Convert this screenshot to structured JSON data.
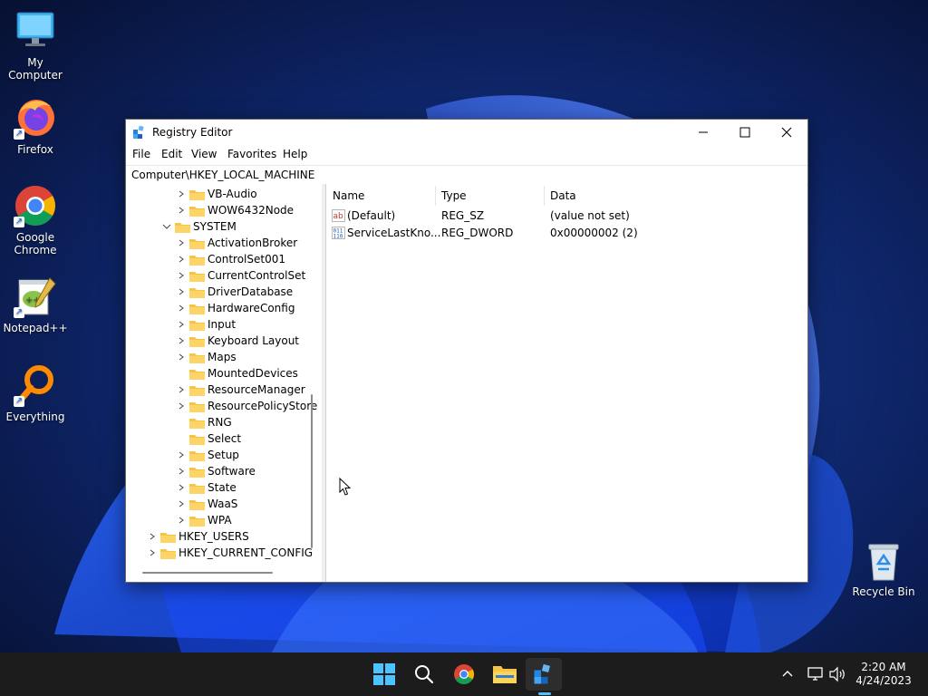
{
  "desktop": {
    "icons": [
      {
        "label": "My Computer",
        "icon": "monitor-icon"
      },
      {
        "label": "Firefox",
        "icon": "firefox-icon"
      },
      {
        "label": "Google Chrome",
        "icon": "chrome-icon"
      },
      {
        "label": "Notepad++",
        "icon": "notepadpp-icon"
      },
      {
        "label": "Everything",
        "icon": "search-everything-icon"
      }
    ],
    "recycle_bin": {
      "label": "Recycle Bin",
      "icon": "recycle-bin-icon"
    }
  },
  "window": {
    "title": "Registry Editor",
    "controls": {
      "minimize": "–",
      "maximize": "☐",
      "close": "✕"
    },
    "menu": [
      "File",
      "Edit",
      "View",
      "Favorites",
      "Help"
    ],
    "address": "Computer\\HKEY_LOCAL_MACHINE",
    "tree": [
      {
        "label": "VB-Audio",
        "expander": "collapsed"
      },
      {
        "label": "WOW6432Node",
        "expander": "collapsed"
      },
      {
        "label": "SYSTEM",
        "expander": "expanded"
      },
      {
        "label": "ActivationBroker",
        "expander": "collapsed"
      },
      {
        "label": "ControlSet001",
        "expander": "collapsed"
      },
      {
        "label": "CurrentControlSet",
        "expander": "collapsed"
      },
      {
        "label": "DriverDatabase",
        "expander": "collapsed"
      },
      {
        "label": "HardwareConfig",
        "expander": "collapsed"
      },
      {
        "label": "Input",
        "expander": "collapsed"
      },
      {
        "label": "Keyboard Layout",
        "expander": "collapsed"
      },
      {
        "label": "Maps",
        "expander": "collapsed"
      },
      {
        "label": "MountedDevices",
        "expander": "none"
      },
      {
        "label": "ResourceManager",
        "expander": "collapsed"
      },
      {
        "label": "ResourcePolicyStore",
        "expander": "collapsed"
      },
      {
        "label": "RNG",
        "expander": "none"
      },
      {
        "label": "Select",
        "expander": "none"
      },
      {
        "label": "Setup",
        "expander": "collapsed"
      },
      {
        "label": "Software",
        "expander": "collapsed"
      },
      {
        "label": "State",
        "expander": "collapsed"
      },
      {
        "label": "WaaS",
        "expander": "collapsed"
      },
      {
        "label": "WPA",
        "expander": "collapsed"
      },
      {
        "label": "HKEY_USERS",
        "expander": "collapsed"
      },
      {
        "label": "HKEY_CURRENT_CONFIG",
        "expander": "collapsed"
      }
    ],
    "columns": [
      "Name",
      "Type",
      "Data"
    ],
    "values": [
      {
        "name": "(Default)",
        "type": "REG_SZ",
        "data": "(value not set)",
        "icon": "string-value-icon"
      },
      {
        "name": "ServiceLastKno...",
        "type": "REG_DWORD",
        "data": "0x00000002 (2)",
        "icon": "binary-value-icon"
      }
    ]
  },
  "taskbar": {
    "items": [
      "start-icon",
      "search-icon",
      "chrome-icon",
      "file-explorer-icon",
      "registry-editor-icon"
    ],
    "time": "2:20 AM",
    "date": "4/24/2023"
  },
  "colors": {
    "accent": "#4cc2ff",
    "folder": "#f8c444",
    "taskbar": "#1c1c1c"
  }
}
